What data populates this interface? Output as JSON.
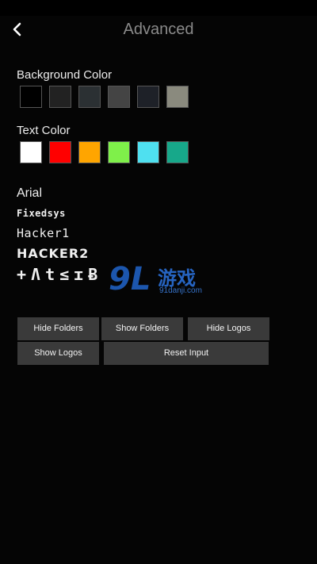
{
  "header": {
    "title": "Advanced",
    "back_icon": "chevron-left-icon"
  },
  "background_color": {
    "label": "Background Color",
    "swatches": [
      "#000000",
      "#222222",
      "#2b3033",
      "#444444",
      "#1e2128",
      "#8a8a7e"
    ]
  },
  "text_color": {
    "label": "Text Color",
    "swatches": [
      "#ffffff",
      "#ff0000",
      "#ffa500",
      "#7ff04a",
      "#4fe0f0",
      "#17a88a"
    ]
  },
  "fonts": {
    "arial": "Arial",
    "fixedsys": "Fixedsys",
    "hacker1": "Hacker1",
    "hacker2": "HACKER2",
    "glyph": "+Ʌt≤ɪɃ"
  },
  "watermark": {
    "mark": "9L",
    "name": "游戏",
    "url": "91danji.com"
  },
  "buttons": {
    "hide_folders": "Hide Folders",
    "show_folders": "Show Folders",
    "hide_logos": "Hide Logos",
    "show_logos": "Show Logos",
    "reset_input": "Reset Input"
  }
}
